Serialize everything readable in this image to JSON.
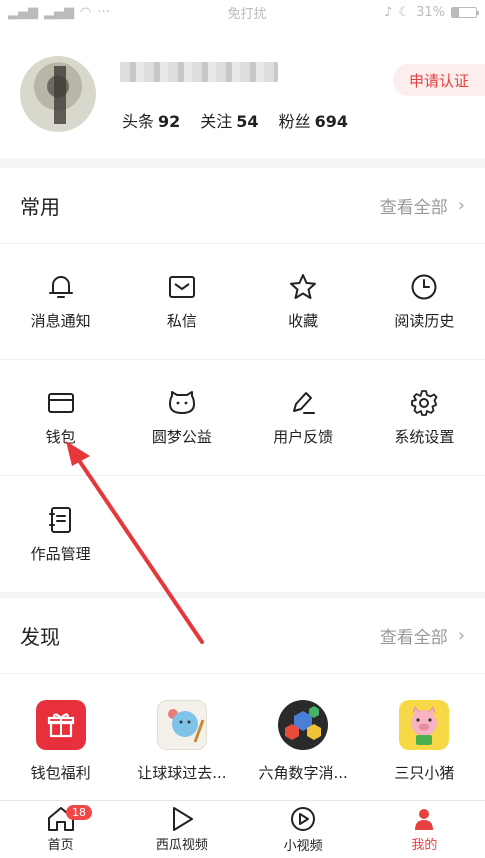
{
  "status_bar": {
    "signal": "ᴵᴵl .ııl",
    "mode": "免打扰",
    "battery_pct": "31%",
    "battery_level": 0.31
  },
  "profile": {
    "stats": [
      {
        "label": "头条",
        "value": "92"
      },
      {
        "label": "关注",
        "value": "54"
      },
      {
        "label": "粉丝",
        "value": "694"
      }
    ],
    "cert_button": "申请认证"
  },
  "common": {
    "title": "常用",
    "see_all": "查看全部",
    "items": [
      {
        "label": "消息通知",
        "icon": "bell-icon"
      },
      {
        "label": "私信",
        "icon": "mail-icon"
      },
      {
        "label": "收藏",
        "icon": "star-icon"
      },
      {
        "label": "阅读历史",
        "icon": "clock-icon"
      },
      {
        "label": "钱包",
        "icon": "wallet-icon"
      },
      {
        "label": "圆梦公益",
        "icon": "cat-face-icon"
      },
      {
        "label": "用户反馈",
        "icon": "pen-icon"
      },
      {
        "label": "系统设置",
        "icon": "gear-icon"
      },
      {
        "label": "作品管理",
        "icon": "notebook-icon"
      }
    ]
  },
  "discover": {
    "title": "发现",
    "see_all": "查看全部",
    "apps": [
      {
        "label": "钱包福利",
        "icon": "gift-icon",
        "color": "#e8303c"
      },
      {
        "label": "让球球过去...",
        "icon": "ball-game-icon",
        "color": "#f3f1ea"
      },
      {
        "label": "六角数字消...",
        "icon": "hexagon-number-icon",
        "color": "#2a2a2a"
      },
      {
        "label": "三只小猪",
        "icon": "pig-icon",
        "color": "#f7d948"
      }
    ]
  },
  "tabbar": {
    "tabs": [
      {
        "label": "首页",
        "icon": "home-icon",
        "badge": "18"
      },
      {
        "label": "西瓜视频",
        "icon": "play-icon"
      },
      {
        "label": "小视频",
        "icon": "short-video-icon"
      },
      {
        "label": "我的",
        "icon": "person-icon",
        "active": true
      }
    ]
  },
  "colors": {
    "accent": "#e94040",
    "annotation_arrow": "#e8373a"
  }
}
